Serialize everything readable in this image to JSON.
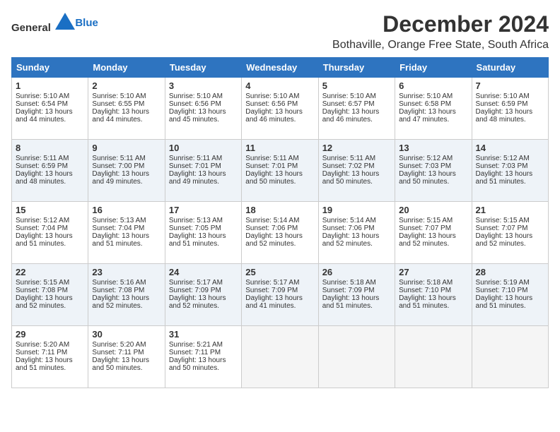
{
  "logo": {
    "general": "General",
    "blue": "Blue"
  },
  "title": "December 2024",
  "subtitle": "Bothaville, Orange Free State, South Africa",
  "days_of_week": [
    "Sunday",
    "Monday",
    "Tuesday",
    "Wednesday",
    "Thursday",
    "Friday",
    "Saturday"
  ],
  "weeks": [
    [
      {
        "day": "1",
        "lines": [
          "Sunrise: 5:10 AM",
          "Sunset: 6:54 PM",
          "Daylight: 13 hours",
          "and 44 minutes."
        ]
      },
      {
        "day": "2",
        "lines": [
          "Sunrise: 5:10 AM",
          "Sunset: 6:55 PM",
          "Daylight: 13 hours",
          "and 44 minutes."
        ]
      },
      {
        "day": "3",
        "lines": [
          "Sunrise: 5:10 AM",
          "Sunset: 6:56 PM",
          "Daylight: 13 hours",
          "and 45 minutes."
        ]
      },
      {
        "day": "4",
        "lines": [
          "Sunrise: 5:10 AM",
          "Sunset: 6:56 PM",
          "Daylight: 13 hours",
          "and 46 minutes."
        ]
      },
      {
        "day": "5",
        "lines": [
          "Sunrise: 5:10 AM",
          "Sunset: 6:57 PM",
          "Daylight: 13 hours",
          "and 46 minutes."
        ]
      },
      {
        "day": "6",
        "lines": [
          "Sunrise: 5:10 AM",
          "Sunset: 6:58 PM",
          "Daylight: 13 hours",
          "and 47 minutes."
        ]
      },
      {
        "day": "7",
        "lines": [
          "Sunrise: 5:10 AM",
          "Sunset: 6:59 PM",
          "Daylight: 13 hours",
          "and 48 minutes."
        ]
      }
    ],
    [
      {
        "day": "8",
        "lines": [
          "Sunrise: 5:11 AM",
          "Sunset: 6:59 PM",
          "Daylight: 13 hours",
          "and 48 minutes."
        ]
      },
      {
        "day": "9",
        "lines": [
          "Sunrise: 5:11 AM",
          "Sunset: 7:00 PM",
          "Daylight: 13 hours",
          "and 49 minutes."
        ]
      },
      {
        "day": "10",
        "lines": [
          "Sunrise: 5:11 AM",
          "Sunset: 7:01 PM",
          "Daylight: 13 hours",
          "and 49 minutes."
        ]
      },
      {
        "day": "11",
        "lines": [
          "Sunrise: 5:11 AM",
          "Sunset: 7:01 PM",
          "Daylight: 13 hours",
          "and 50 minutes."
        ]
      },
      {
        "day": "12",
        "lines": [
          "Sunrise: 5:11 AM",
          "Sunset: 7:02 PM",
          "Daylight: 13 hours",
          "and 50 minutes."
        ]
      },
      {
        "day": "13",
        "lines": [
          "Sunrise: 5:12 AM",
          "Sunset: 7:03 PM",
          "Daylight: 13 hours",
          "and 50 minutes."
        ]
      },
      {
        "day": "14",
        "lines": [
          "Sunrise: 5:12 AM",
          "Sunset: 7:03 PM",
          "Daylight: 13 hours",
          "and 51 minutes."
        ]
      }
    ],
    [
      {
        "day": "15",
        "lines": [
          "Sunrise: 5:12 AM",
          "Sunset: 7:04 PM",
          "Daylight: 13 hours",
          "and 51 minutes."
        ]
      },
      {
        "day": "16",
        "lines": [
          "Sunrise: 5:13 AM",
          "Sunset: 7:04 PM",
          "Daylight: 13 hours",
          "and 51 minutes."
        ]
      },
      {
        "day": "17",
        "lines": [
          "Sunrise: 5:13 AM",
          "Sunset: 7:05 PM",
          "Daylight: 13 hours",
          "and 51 minutes."
        ]
      },
      {
        "day": "18",
        "lines": [
          "Sunrise: 5:14 AM",
          "Sunset: 7:06 PM",
          "Daylight: 13 hours",
          "and 52 minutes."
        ]
      },
      {
        "day": "19",
        "lines": [
          "Sunrise: 5:14 AM",
          "Sunset: 7:06 PM",
          "Daylight: 13 hours",
          "and 52 minutes."
        ]
      },
      {
        "day": "20",
        "lines": [
          "Sunrise: 5:15 AM",
          "Sunset: 7:07 PM",
          "Daylight: 13 hours",
          "and 52 minutes."
        ]
      },
      {
        "day": "21",
        "lines": [
          "Sunrise: 5:15 AM",
          "Sunset: 7:07 PM",
          "Daylight: 13 hours",
          "and 52 minutes."
        ]
      }
    ],
    [
      {
        "day": "22",
        "lines": [
          "Sunrise: 5:15 AM",
          "Sunset: 7:08 PM",
          "Daylight: 13 hours",
          "and 52 minutes."
        ]
      },
      {
        "day": "23",
        "lines": [
          "Sunrise: 5:16 AM",
          "Sunset: 7:08 PM",
          "Daylight: 13 hours",
          "and 52 minutes."
        ]
      },
      {
        "day": "24",
        "lines": [
          "Sunrise: 5:17 AM",
          "Sunset: 7:09 PM",
          "Daylight: 13 hours",
          "and 52 minutes."
        ]
      },
      {
        "day": "25",
        "lines": [
          "Sunrise: 5:17 AM",
          "Sunset: 7:09 PM",
          "Daylight: 13 hours",
          "and 41 minutes."
        ]
      },
      {
        "day": "26",
        "lines": [
          "Sunrise: 5:18 AM",
          "Sunset: 7:09 PM",
          "Daylight: 13 hours",
          "and 51 minutes."
        ]
      },
      {
        "day": "27",
        "lines": [
          "Sunrise: 5:18 AM",
          "Sunset: 7:10 PM",
          "Daylight: 13 hours",
          "and 51 minutes."
        ]
      },
      {
        "day": "28",
        "lines": [
          "Sunrise: 5:19 AM",
          "Sunset: 7:10 PM",
          "Daylight: 13 hours",
          "and 51 minutes."
        ]
      }
    ],
    [
      {
        "day": "29",
        "lines": [
          "Sunrise: 5:20 AM",
          "Sunset: 7:11 PM",
          "Daylight: 13 hours",
          "and 51 minutes."
        ]
      },
      {
        "day": "30",
        "lines": [
          "Sunrise: 5:20 AM",
          "Sunset: 7:11 PM",
          "Daylight: 13 hours",
          "and 50 minutes."
        ]
      },
      {
        "day": "31",
        "lines": [
          "Sunrise: 5:21 AM",
          "Sunset: 7:11 PM",
          "Daylight: 13 hours",
          "and 50 minutes."
        ]
      },
      {
        "day": "",
        "lines": []
      },
      {
        "day": "",
        "lines": []
      },
      {
        "day": "",
        "lines": []
      },
      {
        "day": "",
        "lines": []
      }
    ]
  ]
}
